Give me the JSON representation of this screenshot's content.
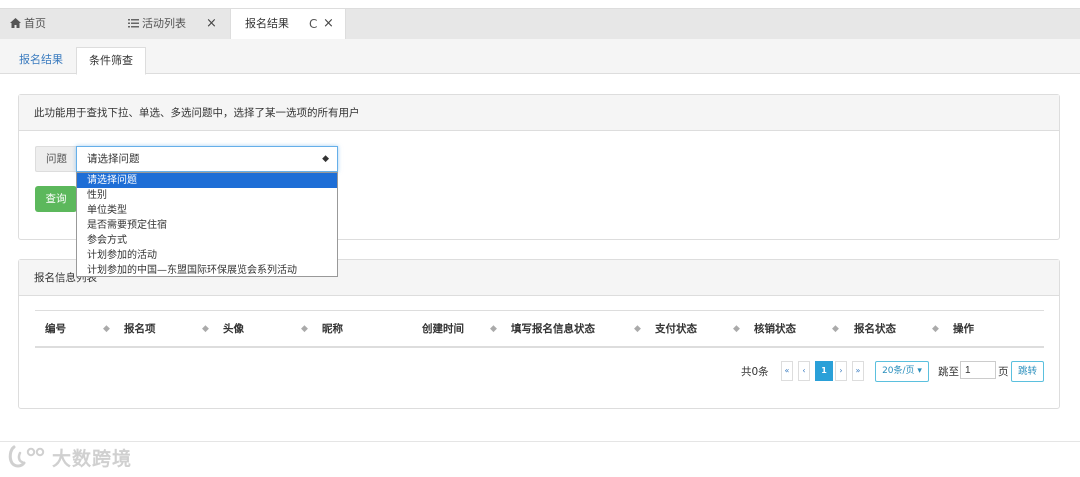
{
  "top_tabs": {
    "home": "首页",
    "activity_list": "活动列表",
    "signup_result": "报名结果",
    "close_glyph": "×",
    "refresh_glyph": "C"
  },
  "sub_tabs": {
    "tab1": "报名结果",
    "tab2": "条件筛查"
  },
  "filter_panel": {
    "header": "此功能用于查找下拉、单选、多选问题中，选择了某一选项的所有用户",
    "question_label": "问题",
    "select_value": "请选择问题",
    "select_arrow": "◆",
    "query_button": "查询",
    "options": [
      "请选择问题",
      "性别",
      "单位类型",
      "是否需要预定住宿",
      "参会方式",
      "计划参加的活动",
      "计划参加的中国—东盟国际环保展览会系列活动"
    ]
  },
  "list_panel": {
    "header": "报名信息列表",
    "columns": [
      "编号",
      "报名项",
      "头像",
      "昵称",
      "创建时间",
      "填写报名信息状态",
      "支付状态",
      "核销状态",
      "报名状态",
      "操作"
    ],
    "sort_glyph": "◆"
  },
  "pagination": {
    "total": "共0条",
    "first": "«",
    "prev": "‹",
    "current": "1",
    "next": "›",
    "last": "»",
    "page_size": "20条/页 ▾",
    "jump_label": "跳至",
    "jump_value": "1",
    "page_label": "页",
    "jump_button": "跳转"
  },
  "watermark": {
    "text": "大数跨境"
  },
  "colors": {
    "primary_blue": "#2aa0d8",
    "success_green": "#5cb85c",
    "dropdown_selected": "#1e6ed6"
  }
}
